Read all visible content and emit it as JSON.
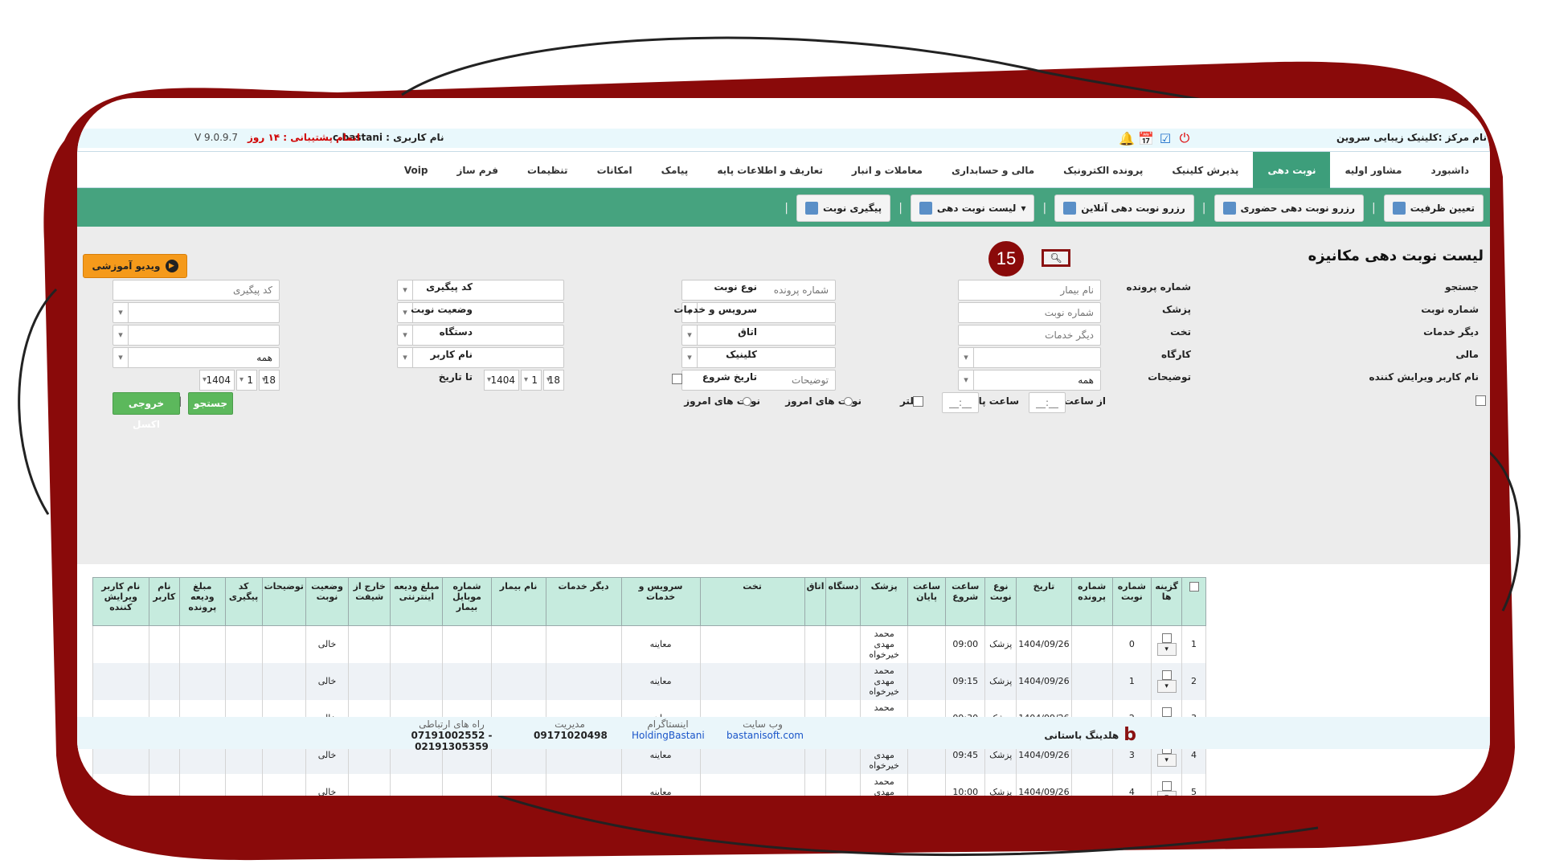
{
  "infobar": {
    "center_name": "نام مرکز :کلینیک زیبایی سروین",
    "user_label": "نام کاربری : c.bastani",
    "support_label": "اتمام پشتیبانی : ۱۴ روز",
    "version": "V 9.0.9.7"
  },
  "menu": [
    {
      "label": "داشبورد"
    },
    {
      "label": "مشاور اولیه"
    },
    {
      "label": "نوبت دهی"
    },
    {
      "label": "پذیرش کلینیک"
    },
    {
      "label": "پرونده الکترونیک"
    },
    {
      "label": "مالی و حسابداری"
    },
    {
      "label": "معاملات و انبار"
    },
    {
      "label": "تعاریف و اطلاعات پایه"
    },
    {
      "label": "پیامک"
    },
    {
      "label": "امکانات"
    },
    {
      "label": "تنظیمات"
    },
    {
      "label": "فرم ساز"
    },
    {
      "label": "Voip"
    }
  ],
  "toolbar": [
    {
      "label": "تعیین ظرفیت"
    },
    {
      "label": "رزرو نوبت دهی حضوری"
    },
    {
      "label": "رزرو نوبت دهی آنلاین"
    },
    {
      "label": "لیست نوبت دهی"
    },
    {
      "label": "پیگیری نوبت"
    }
  ],
  "page": {
    "title": "لیست نوبت دهی مکانیزه",
    "callout_number": "15",
    "video_button": "ویدیو آموزشی"
  },
  "filters": {
    "search_label": "جستجو",
    "search_placeholder": "نام بیمار",
    "file_no_label": "شماره پرونده",
    "file_no_placeholder": "شماره پرونده",
    "appt_type_label": "نوع نوبت",
    "tracking_label": "کد پیگیری",
    "tracking_placeholder": "کد پیگیری",
    "appt_no_label": "شماره نوبت",
    "appt_no_placeholder": "شماره نوبت",
    "doctor_label": "پزشک",
    "service_label": "سرویس و خدمات",
    "appt_status_label": "وضعیت نوبت",
    "other_services_label": "دیگر خدمات",
    "other_services_placeholder": "دیگر خدمات",
    "bed_label": "تخت",
    "room_label": "اتاق",
    "device_label": "دستگاه",
    "financial_label": "مالی",
    "workshop_label": "کارگاه",
    "clinic_label": "کلینیک",
    "username_label": "نام کاربر",
    "username_value": "همه",
    "editor_label": "نام کاربر ویرایش کننده",
    "editor_value": "همه",
    "notes_label": "توضیحات",
    "notes_placeholder": "توضیحات",
    "start_date_label": "تاریخ شروع",
    "end_date_label": "تا تاریخ",
    "date_day": "18",
    "date_month": "1",
    "date_year": "1404",
    "from_time_label": "از ساعت",
    "end_time_label": "ساعت پایان",
    "time_placeholder": "__:__",
    "filter_label": "فیلتر",
    "today_appts_1": "نوبت های امروز",
    "today_appts_2": "نوبت های امروز",
    "search_button": "جستجو",
    "excel_button": "خروجی اکسل"
  },
  "table": {
    "headers": [
      "گزینه ها",
      "شماره نوبت",
      "شماره پرونده",
      "تاریخ",
      "نوع نوبت",
      "ساعت شروع",
      "ساعت پایان",
      "پزشک",
      "دستگاه",
      "اتاق",
      "تخت",
      "سرویس و خدمات",
      "دیگر خدمات",
      "نام بیمار",
      "شماره موبایل بیمار",
      "مبلغ ودیعه اینترنتی",
      "خارج از شیفت",
      "وضعیت نوبت",
      "توضیحات",
      "کد پیگیری",
      "مبلغ ودیعه پرونده",
      "نام کاربر",
      "نام کاربر ویرایش کننده"
    ],
    "rows": [
      {
        "idx": "1",
        "appt_no": "0",
        "date": "1404/09/26",
        "type": "پزشک",
        "start": "09:00",
        "doctor": "محمد مهدی خیرخواه",
        "service": "معاینه",
        "status": "خالی"
      },
      {
        "idx": "2",
        "appt_no": "1",
        "date": "1404/09/26",
        "type": "پزشک",
        "start": "09:15",
        "doctor": "محمد مهدی خیرخواه",
        "service": "معاینه",
        "status": "خالی"
      },
      {
        "idx": "3",
        "appt_no": "2",
        "date": "1404/09/26",
        "type": "پزشک",
        "start": "09:30",
        "doctor": "محمد مهدی خیرخواه",
        "service": "معاینه",
        "status": "خالی"
      },
      {
        "idx": "4",
        "appt_no": "3",
        "date": "1404/09/26",
        "type": "پزشک",
        "start": "09:45",
        "doctor": "محمد مهدی خیرخواه",
        "service": "معاینه",
        "status": "خالی"
      },
      {
        "idx": "5",
        "appt_no": "4",
        "date": "1404/09/26",
        "type": "پزشک",
        "start": "10:00",
        "doctor": "محمد مهدی خیرخواه",
        "service": "معاینه",
        "status": "خالی"
      }
    ]
  },
  "footer": {
    "brand": "هلدینگ باستانی",
    "website_label": "وب سایت",
    "website_value": "bastanisoft.com",
    "instagram_label": "اینستاگرام",
    "instagram_value": "HoldingBastani",
    "management_label": "مدیریت",
    "management_value": "09171020498",
    "contact_label": "راه های ارتباطی",
    "contact_value": "07191002552 - 02191305359"
  },
  "colors": {
    "frame": "#8a0a0a",
    "toolbar": "#46a37f",
    "active_tab": "#3d9e7b",
    "header_cell": "#c6ebde",
    "video_button": "#f59a1b",
    "green_button": "#5cb85c"
  }
}
